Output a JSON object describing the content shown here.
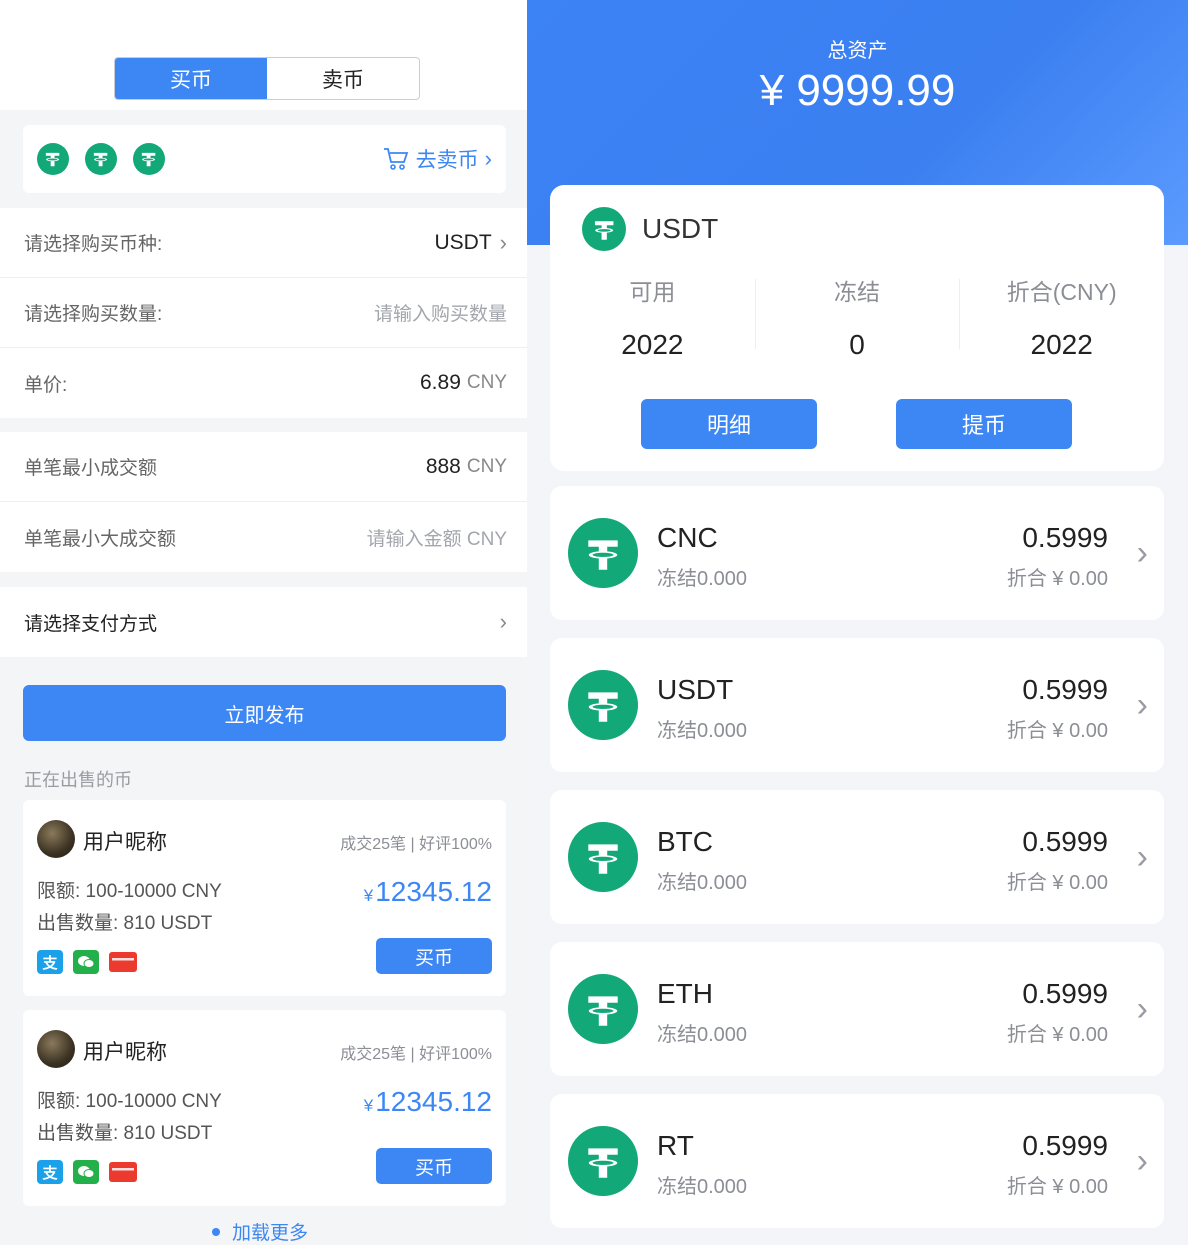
{
  "left": {
    "tabs": {
      "buy": "买币",
      "sell": "卖币"
    },
    "coinbar": {
      "icon": "tether-icon",
      "go_sell": "去卖币"
    },
    "form": [
      {
        "label": "请选择购买币种:",
        "value": "USDT",
        "chevron": "›"
      },
      {
        "label": "请选择购买数量:",
        "placeholder": "请输入购买数量"
      },
      {
        "label": "单价:",
        "value": "6.89",
        "unit": "CNY"
      }
    ],
    "limits": [
      {
        "label": "单笔最小成交额",
        "value": "888",
        "unit": "CNY"
      },
      {
        "label": "单笔最小大成交额",
        "placeholder": "请输入金额 CNY"
      }
    ],
    "payment": {
      "label": "请选择支付方式",
      "chevron": "›"
    },
    "publish": "立即发布",
    "onsale_title": "正在出售的币",
    "offers": [
      {
        "user": "用户昵称",
        "stats": "成交25笔 | 好评100%",
        "limit": "限额:  100-10000 CNY",
        "qty": "出售数量:  810 USDT",
        "currency": "¥",
        "price": "12345.12",
        "buy": "买币",
        "alipay": "支"
      },
      {
        "user": "用户昵称",
        "stats": "成交25笔 | 好评100%",
        "limit": "限额:  100-10000 CNY",
        "qty": "出售数量:  810 USDT",
        "currency": "¥",
        "price": "12345.12",
        "buy": "买币",
        "alipay": "支"
      }
    ],
    "load_more": "加载更多"
  },
  "right": {
    "total_label": "总资产",
    "total_value": "¥ 9999.99",
    "usdt_card": {
      "name": "USDT",
      "cols": [
        {
          "label": "可用",
          "value": "2022"
        },
        {
          "label": "冻结",
          "value": "0"
        },
        {
          "label": "折合(CNY)",
          "value": "2022"
        }
      ],
      "detail": "明细",
      "withdraw": "提币"
    },
    "coins": [
      {
        "name": "CNC",
        "frozen": "冻结0.000",
        "balance": "0.5999",
        "cny": "折合 ¥ 0.00"
      },
      {
        "name": "USDT",
        "frozen": "冻结0.000",
        "balance": "0.5999",
        "cny": "折合 ¥ 0.00"
      },
      {
        "name": "BTC",
        "frozen": "冻结0.000",
        "balance": "0.5999",
        "cny": "折合 ¥ 0.00"
      },
      {
        "name": "ETH",
        "frozen": "冻结0.000",
        "balance": "0.5999",
        "cny": "折合 ¥ 0.00"
      },
      {
        "name": "RT",
        "frozen": "冻结0.000",
        "balance": "0.5999",
        "cny": "折合 ¥ 0.00"
      }
    ],
    "chevron": "›"
  },
  "colors": {
    "accent": "#3d87f5",
    "tether": "#13a877"
  }
}
